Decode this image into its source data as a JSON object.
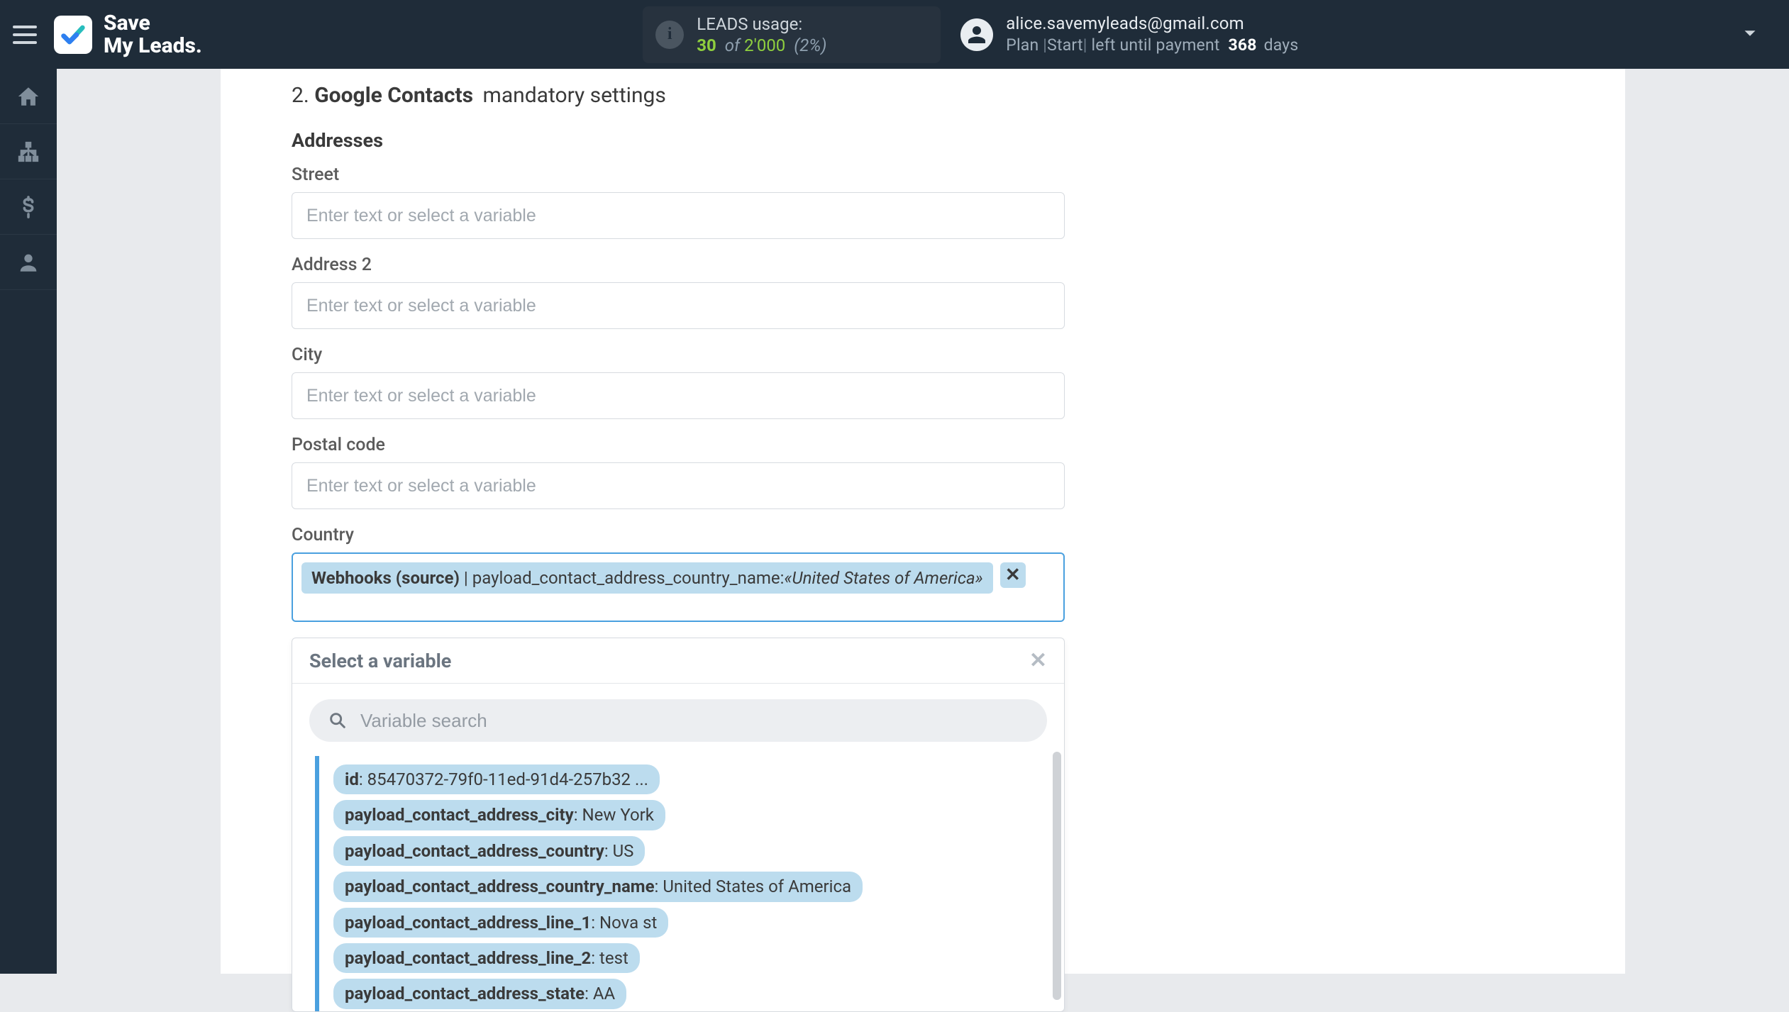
{
  "brand": {
    "line1": "Save",
    "line2": "My Leads."
  },
  "header": {
    "usage_label": "LEADS usage:",
    "usage_current": "30",
    "usage_of": "of",
    "usage_limit": "2'000",
    "usage_pct": "(2%)",
    "account_email": "alice.savemyleads@gmail.com",
    "plan_prefix": "Plan",
    "plan_name": "Start",
    "plan_suffix": "left until payment",
    "days": "368",
    "days_label": "days"
  },
  "section": {
    "number": "2.",
    "bold": "Google Contacts",
    "rest": "mandatory settings",
    "addresses_heading": "Addresses"
  },
  "fields": {
    "street": {
      "label": "Street",
      "placeholder": "Enter text or select a variable"
    },
    "address2": {
      "label": "Address 2",
      "placeholder": "Enter text or select a variable"
    },
    "city": {
      "label": "City",
      "placeholder": "Enter text or select a variable"
    },
    "postal": {
      "label": "Postal code",
      "placeholder": "Enter text or select a variable"
    },
    "country": {
      "label": "Country"
    }
  },
  "country_tag": {
    "source": "Webhooks (source)",
    "pipe": " | ",
    "key": "payload_contact_address_country_name: ",
    "value": "«United States of America»",
    "remove": "✕"
  },
  "dropdown": {
    "title": "Select a variable",
    "close": "✕",
    "search_placeholder": "Variable search",
    "items": [
      {
        "key": "id",
        "value": "85470372-79f0-11ed-91d4-257b32 ..."
      },
      {
        "key": "payload_contact_address_city",
        "value": "New York"
      },
      {
        "key": "payload_contact_address_country",
        "value": "US"
      },
      {
        "key": "payload_contact_address_country_name",
        "value": "United States of America"
      },
      {
        "key": "payload_contact_address_line_1",
        "value": "Nova st"
      },
      {
        "key": "payload_contact_address_line_2",
        "value": "test"
      },
      {
        "key": "payload_contact_address_state",
        "value": "AA"
      }
    ]
  }
}
